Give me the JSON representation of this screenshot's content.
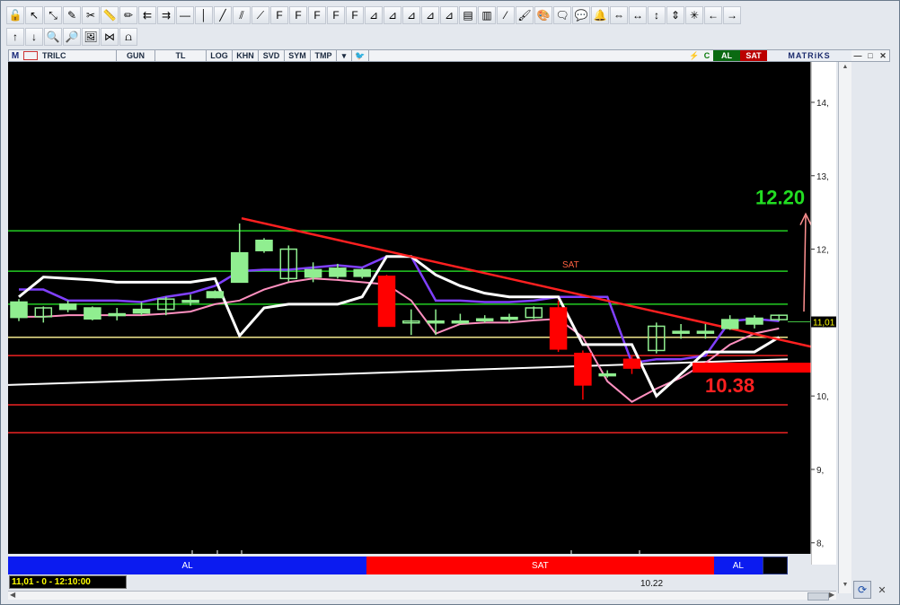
{
  "toolbar": {
    "row1": [
      {
        "name": "lock-icon",
        "glyph": "🔓"
      },
      {
        "name": "pointer-arrow-icon",
        "glyph": "↖"
      },
      {
        "name": "resize-icon",
        "glyph": "⤡"
      },
      {
        "name": "edit-icon",
        "glyph": "✎"
      },
      {
        "name": "tools-icon",
        "glyph": "✂"
      },
      {
        "name": "ruler-icon",
        "glyph": "📏"
      },
      {
        "name": "pencil-icon",
        "glyph": "✏"
      },
      {
        "name": "channel-left-icon",
        "glyph": "⇇"
      },
      {
        "name": "channel-right-icon",
        "glyph": "⇉"
      },
      {
        "name": "horizontal-line-icon",
        "glyph": "—"
      },
      {
        "name": "vertical-line-icon",
        "glyph": "│"
      },
      {
        "name": "trend-line-icon",
        "glyph": "╱"
      },
      {
        "name": "parallel-lines-icon",
        "glyph": "⫽"
      },
      {
        "name": "fan-lines-icon",
        "glyph": "⟋"
      },
      {
        "name": "fibonacci-icon",
        "glyph": "F"
      },
      {
        "name": "fibonacci-fan-icon",
        "glyph": "F"
      },
      {
        "name": "fibonacci-arc-icon",
        "glyph": "F"
      },
      {
        "name": "fibonacci-time-icon",
        "glyph": "F"
      },
      {
        "name": "fibonacci-ext-icon",
        "glyph": "F"
      },
      {
        "name": "gann-icon",
        "glyph": "⊿"
      },
      {
        "name": "gann-fan-icon",
        "glyph": "⊿"
      },
      {
        "name": "speed-lines-icon",
        "glyph": "⊿"
      },
      {
        "name": "andrews-icon",
        "glyph": "⊿"
      },
      {
        "name": "cycles-icon",
        "glyph": "⊿"
      },
      {
        "name": "regression-icon",
        "glyph": "▤"
      },
      {
        "name": "raff-channel-icon",
        "glyph": "▥"
      },
      {
        "name": "wedge-icon",
        "glyph": "⁄"
      },
      {
        "name": "brush-icon",
        "glyph": "🖌"
      },
      {
        "name": "palette-icon",
        "glyph": "🎨"
      },
      {
        "name": "note-icon",
        "glyph": "🗨"
      },
      {
        "name": "comment-icon",
        "glyph": "💬"
      },
      {
        "name": "alarm-bell-icon",
        "glyph": "🔔"
      },
      {
        "name": "arrows-in-icon",
        "glyph": "⇔"
      },
      {
        "name": "arrows-out-icon",
        "glyph": "↔"
      },
      {
        "name": "arrows-up-icon",
        "glyph": "↕"
      },
      {
        "name": "arrows-updown-icon",
        "glyph": "⇕"
      },
      {
        "name": "settings-star-icon",
        "glyph": "✳"
      },
      {
        "name": "arrow-left-icon",
        "glyph": "←"
      },
      {
        "name": "arrow-right-icon",
        "glyph": "→"
      }
    ],
    "row2": [
      {
        "name": "arrow-up-icon",
        "glyph": "↑"
      },
      {
        "name": "arrow-down-icon",
        "glyph": "↓"
      },
      {
        "name": "zoom-in-icon",
        "glyph": "🔍"
      },
      {
        "name": "zoom-out-icon",
        "glyph": "🔎"
      },
      {
        "name": "image-icon",
        "glyph": "🖼"
      },
      {
        "name": "pattern-icon",
        "glyph": "⋈"
      },
      {
        "name": "magnet-icon",
        "glyph": "⩍"
      }
    ]
  },
  "chart_header": {
    "m_label": "M",
    "symbol": "TRILC",
    "periods": [
      "GUN",
      "TL",
      "LOG",
      "KHN",
      "SVD",
      "SYM",
      "TMP"
    ],
    "dropdown": "▾",
    "bird_icon": "🐦",
    "lightning": "⚡",
    "c_label": "C",
    "al_label": "AL",
    "sat_label": "SAT",
    "brand": "MATRiKS",
    "min": "—",
    "max": "□",
    "close": "✕"
  },
  "chart_data": {
    "type": "candlestick",
    "y_axis_labels": [
      "14,",
      "13,",
      "12,",
      "11,",
      "10,",
      "9,",
      "8,"
    ],
    "y_axis_values": [
      14,
      13,
      12,
      11,
      10,
      9,
      8
    ],
    "current_price_label": "11,01",
    "current_price": 11.01,
    "target_label": "12.20",
    "target_value": 12.2,
    "support_label": "10.38",
    "support_value": 10.38,
    "signal_text": "SAT",
    "x_label": "10.22",
    "horizontal_levels": [
      {
        "value": 12.25,
        "color": "#22cc22"
      },
      {
        "value": 11.7,
        "color": "#22cc22"
      },
      {
        "value": 11.25,
        "color": "#22cc22"
      },
      {
        "value": 10.8,
        "color": "#f0e68c"
      },
      {
        "value": 10.55,
        "color": "#ee2222"
      },
      {
        "value": 9.88,
        "color": "#ee2222"
      },
      {
        "value": 9.5,
        "color": "#ee2222"
      }
    ],
    "candles": [
      {
        "o": 11.07,
        "c": 11.28,
        "h": 11.32,
        "l": 11.02
      },
      {
        "o": 11.08,
        "c": 11.2,
        "h": 11.22,
        "l": 11.0
      },
      {
        "o": 11.18,
        "c": 11.25,
        "h": 11.3,
        "l": 11.14
      },
      {
        "o": 11.05,
        "c": 11.2,
        "h": 11.22,
        "l": 11.03
      },
      {
        "o": 11.1,
        "c": 11.12,
        "h": 11.2,
        "l": 11.03
      },
      {
        "o": 11.13,
        "c": 11.18,
        "h": 11.28,
        "l": 11.1
      },
      {
        "o": 11.18,
        "c": 11.32,
        "h": 11.35,
        "l": 11.1
      },
      {
        "o": 11.28,
        "c": 11.3,
        "h": 11.38,
        "l": 11.23
      },
      {
        "o": 11.34,
        "c": 11.42,
        "h": 11.44,
        "l": 11.33
      },
      {
        "o": 11.55,
        "c": 11.95,
        "h": 12.35,
        "l": 11.55
      },
      {
        "o": 11.98,
        "c": 12.12,
        "h": 12.15,
        "l": 11.95
      },
      {
        "o": 11.6,
        "c": 12.0,
        "h": 12.05,
        "l": 11.56
      },
      {
        "o": 11.62,
        "c": 11.72,
        "h": 11.82,
        "l": 11.55
      },
      {
        "o": 11.63,
        "c": 11.74,
        "h": 11.8,
        "l": 11.6
      },
      {
        "o": 11.63,
        "c": 11.72,
        "h": 11.74,
        "l": 11.6
      },
      {
        "o": 11.63,
        "c": 10.95,
        "h": 11.65,
        "l": 10.95
      },
      {
        "o": 11.02,
        "c": 11.02,
        "h": 11.18,
        "l": 10.83
      },
      {
        "o": 11.02,
        "c": 11.02,
        "h": 11.18,
        "l": 10.83
      },
      {
        "o": 11.02,
        "c": 11.02,
        "h": 11.12,
        "l": 10.98
      },
      {
        "o": 11.05,
        "c": 11.05,
        "h": 11.1,
        "l": 11.0
      },
      {
        "o": 11.05,
        "c": 11.07,
        "h": 11.12,
        "l": 11.0
      },
      {
        "o": 11.07,
        "c": 11.2,
        "h": 11.22,
        "l": 11.05
      },
      {
        "o": 11.2,
        "c": 10.64,
        "h": 11.3,
        "l": 10.6
      },
      {
        "o": 10.58,
        "c": 10.15,
        "h": 10.62,
        "l": 9.95
      },
      {
        "o": 10.3,
        "c": 10.3,
        "h": 10.35,
        "l": 10.25
      },
      {
        "o": 10.5,
        "c": 10.38,
        "h": 10.55,
        "l": 10.3
      },
      {
        "o": 10.62,
        "c": 10.95,
        "h": 11.0,
        "l": 10.58
      },
      {
        "o": 10.88,
        "c": 10.88,
        "h": 10.98,
        "l": 10.78
      },
      {
        "o": 10.88,
        "c": 10.88,
        "h": 10.98,
        "l": 10.78
      },
      {
        "o": 10.92,
        "c": 11.04,
        "h": 11.1,
        "l": 10.9
      },
      {
        "o": 10.98,
        "c": 11.06,
        "h": 11.1,
        "l": 10.92
      },
      {
        "o": 11.04,
        "c": 11.1,
        "h": 11.11,
        "l": 11.02
      }
    ],
    "bull_color": "#90ee90",
    "bear_color": "#ff0000",
    "purple_line_color": "#8040ff",
    "white_line_color": "#ffffff",
    "pink_line_color": "#ff90c0",
    "trend_line_color": "#ff2020"
  },
  "signals": [
    {
      "label": "AL",
      "type": "al",
      "fraction": 0.46
    },
    {
      "label": "SAT",
      "type": "sat",
      "fraction": 0.445
    },
    {
      "label": "AL",
      "type": "al",
      "fraction": 0.063
    },
    {
      "label": "",
      "type": "empty",
      "fraction": 0.032
    }
  ],
  "status": {
    "readout": "11,01 - 0 - 12:10:00",
    "date": "10.22"
  },
  "corner": {
    "glyph": "⟳",
    "close": "✕"
  }
}
